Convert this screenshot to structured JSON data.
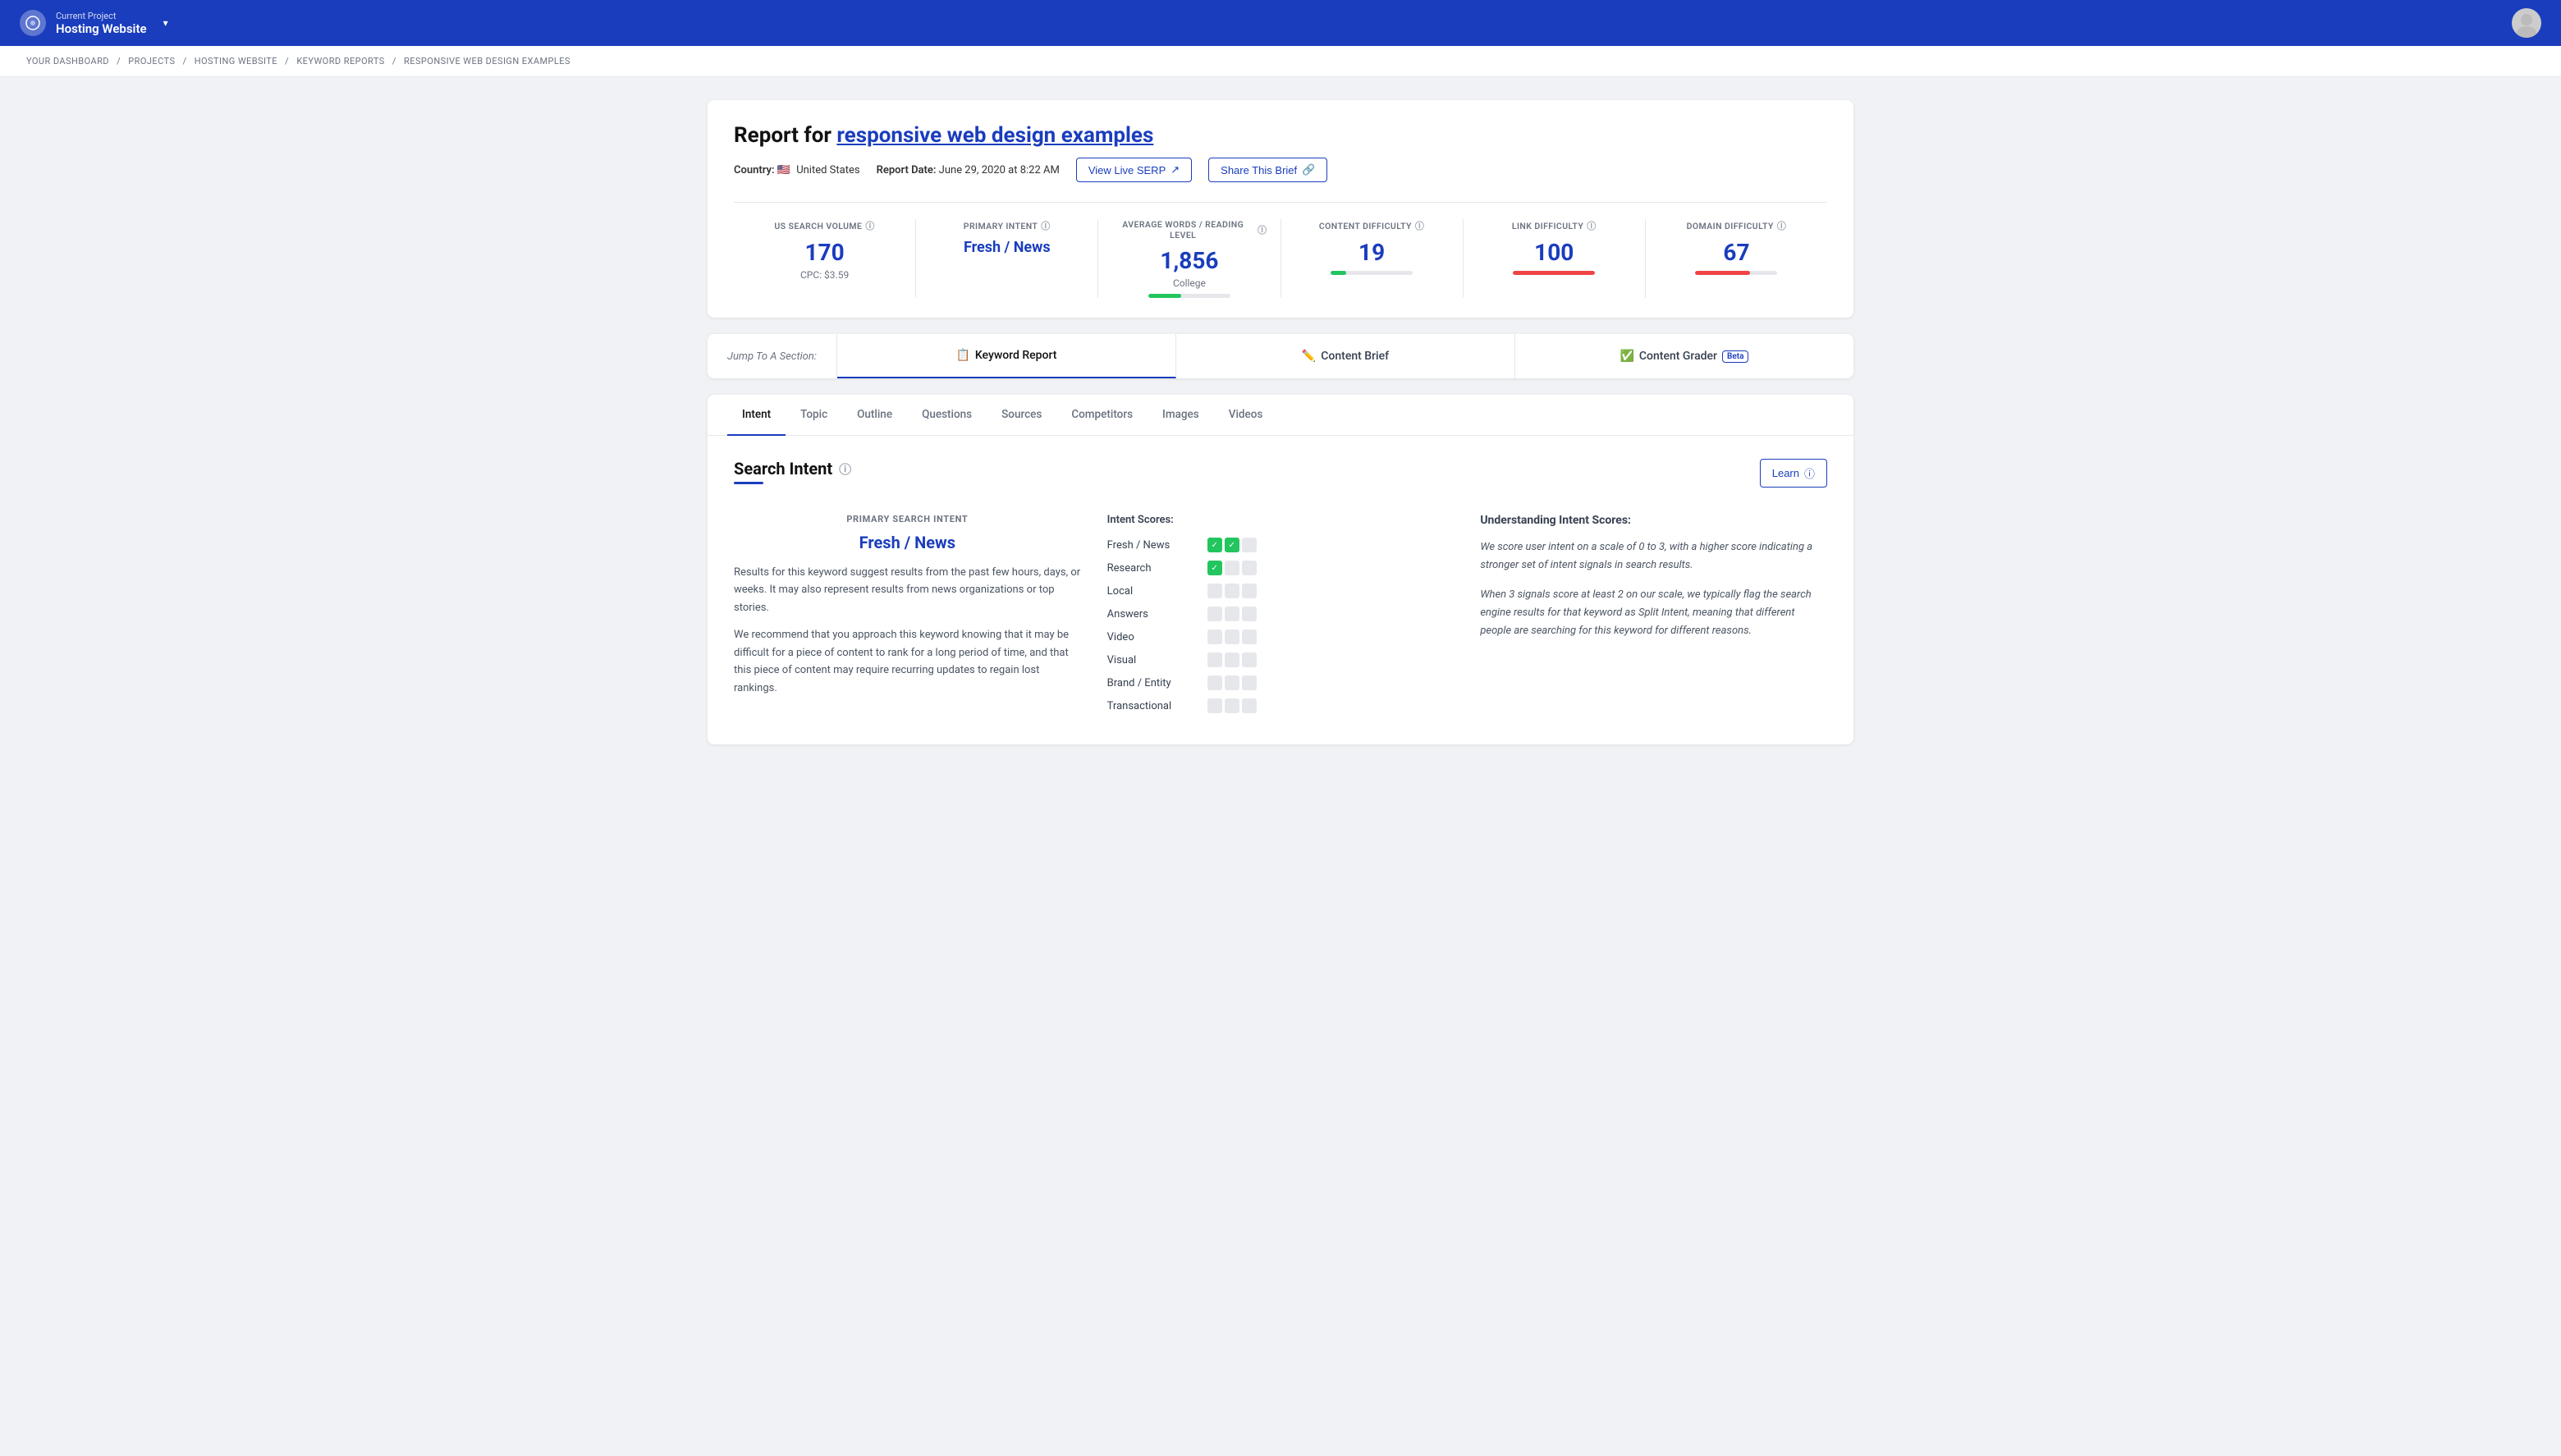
{
  "topNav": {
    "currentProjectLabel": "Current Project",
    "projectName": "Hosting Website",
    "avatarAlt": "User Avatar"
  },
  "breadcrumb": {
    "items": [
      "YOUR DASHBOARD",
      "PROJECTS",
      "HOSTING WEBSITE",
      "KEYWORD REPORTS",
      "RESPONSIVE WEB DESIGN EXAMPLES"
    ],
    "separator": "/"
  },
  "report": {
    "titlePrefix": "Report for",
    "titleKeyword": "responsive web design examples",
    "countryFlag": "🇺🇸",
    "countryName": "United States",
    "reportDateLabel": "Report Date:",
    "reportDate": "June 29, 2020 at 8:22 AM",
    "viewLiveSerpBtn": "View Live SERP",
    "shareThisBriefBtn": "Share This Brief",
    "stats": [
      {
        "label": "US SEARCH VOLUME",
        "value": "170",
        "sub": "CPC: $3.59",
        "progressPct": 0,
        "progressColor": "",
        "valueColor": "blue"
      },
      {
        "label": "PRIMARY INTENT",
        "value": "Fresh / News",
        "sub": "",
        "progressPct": 0,
        "progressColor": "",
        "valueColor": "blue",
        "isLink": true
      },
      {
        "label": "AVERAGE WORDS / READING LEVEL",
        "value": "1,856",
        "sub": "College",
        "progressPct": 40,
        "progressColor": "green",
        "valueColor": "blue"
      },
      {
        "label": "CONTENT DIFFICULTY",
        "value": "19",
        "sub": "",
        "progressPct": 19,
        "progressColor": "green",
        "valueColor": "blue"
      },
      {
        "label": "LINK DIFFICULTY",
        "value": "100",
        "sub": "",
        "progressPct": 100,
        "progressColor": "red",
        "valueColor": "blue"
      },
      {
        "label": "DOMAIN DIFFICULTY",
        "value": "67",
        "sub": "",
        "progressPct": 67,
        "progressColor": "red",
        "valueColor": "blue"
      }
    ]
  },
  "sectionTabs": {
    "jumpLabel": "Jump To A Section:",
    "tabs": [
      {
        "id": "keyword-report",
        "icon": "📋",
        "label": "Keyword Report",
        "active": true
      },
      {
        "id": "content-brief",
        "icon": "✏️",
        "label": "Content Brief",
        "active": false
      },
      {
        "id": "content-grader",
        "icon": "✅",
        "label": "Content Grader",
        "active": false,
        "badge": "Beta"
      }
    ]
  },
  "subTabs": {
    "tabs": [
      {
        "id": "intent",
        "label": "Intent",
        "active": true
      },
      {
        "id": "topic",
        "label": "Topic",
        "active": false
      },
      {
        "id": "outline",
        "label": "Outline",
        "active": false
      },
      {
        "id": "questions",
        "label": "Questions",
        "active": false
      },
      {
        "id": "sources",
        "label": "Sources",
        "active": false
      },
      {
        "id": "competitors",
        "label": "Competitors",
        "active": false
      },
      {
        "id": "images",
        "label": "Images",
        "active": false
      },
      {
        "id": "videos",
        "label": "Videos",
        "active": false
      }
    ]
  },
  "searchIntent": {
    "sectionTitle": "Search Intent",
    "learnBtn": "Learn",
    "primaryIntentLabel": "PRIMARY SEARCH INTENT",
    "primaryIntentValue": "Fresh / News",
    "intentDesc1": "Results for this keyword suggest results from the past few hours, days, or weeks. It may also represent results from news organizations or top stories.",
    "intentDesc2": "We recommend that you approach this keyword knowing that it may be difficult for a piece of content to rank for a long period of time, and that this piece of content may require recurring updates to regain lost rankings.",
    "intentScoresTitle": "Intent Scores:",
    "intentScores": [
      {
        "name": "Fresh / News",
        "scores": [
          true,
          true,
          false
        ]
      },
      {
        "name": "Research",
        "scores": [
          true,
          false,
          false
        ]
      },
      {
        "name": "Local",
        "scores": [
          false,
          false,
          false
        ]
      },
      {
        "name": "Answers",
        "scores": [
          false,
          false,
          false
        ]
      },
      {
        "name": "Video",
        "scores": [
          false,
          false,
          false
        ]
      },
      {
        "name": "Visual",
        "scores": [
          false,
          false,
          false
        ]
      },
      {
        "name": "Brand / Entity",
        "scores": [
          false,
          false,
          false
        ]
      },
      {
        "name": "Transactional",
        "scores": [
          false,
          false,
          false
        ]
      }
    ],
    "understandingTitle": "Understanding Intent Scores:",
    "understandingText1": "We score user intent on a scale of 0 to 3, with a higher score indicating a stronger set of intent signals in search results.",
    "understandingText2": "When 3 signals score at least 2 on our scale, we typically flag the search engine results for that keyword as Split Intent, meaning that different people are searching for this keyword for different reasons."
  }
}
